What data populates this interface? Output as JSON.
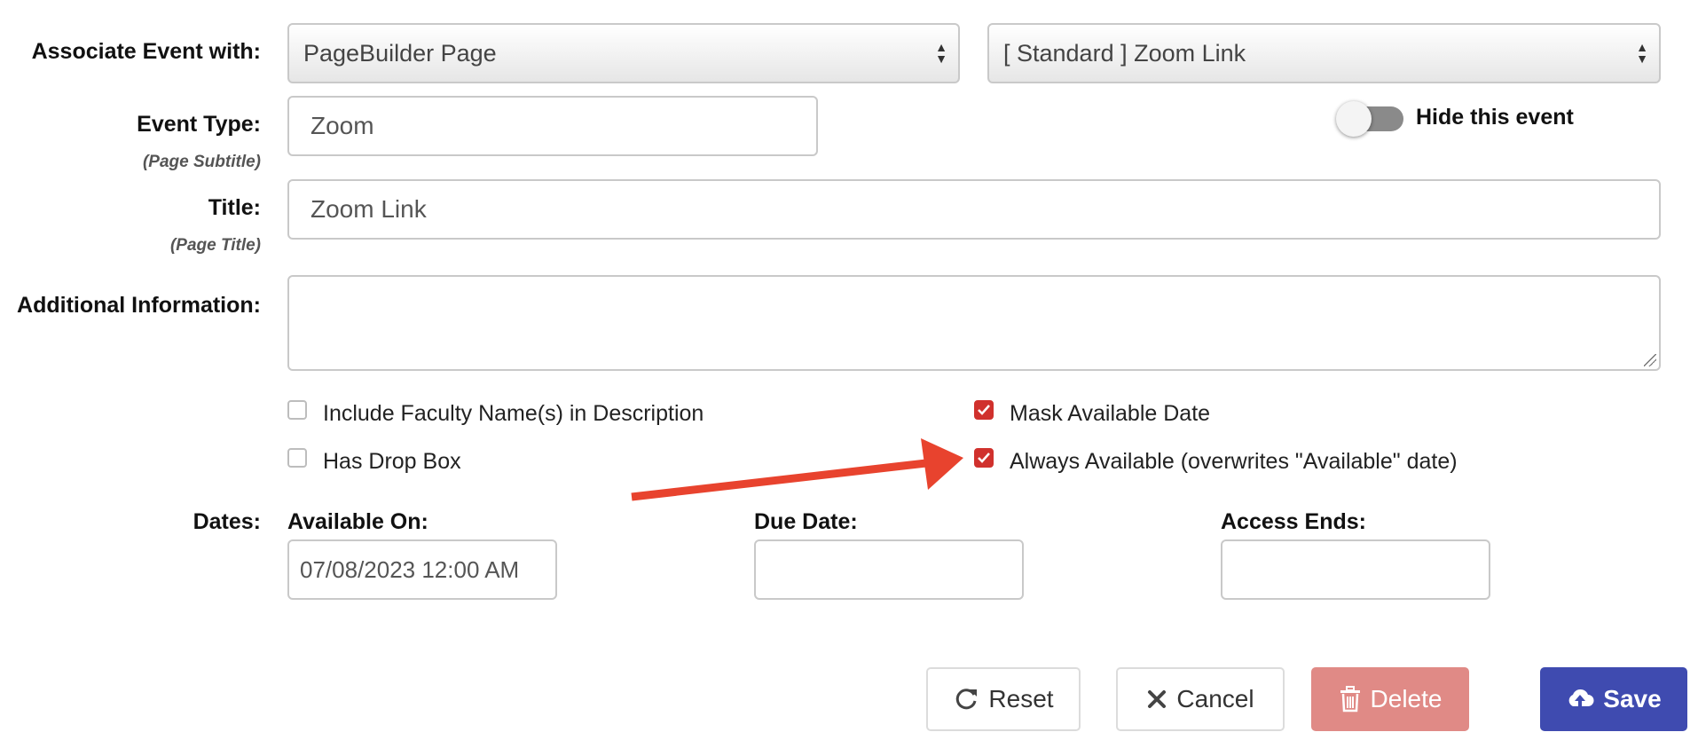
{
  "associate": {
    "label": "Associate Event with:",
    "type_select": "PageBuilder Page",
    "item_select": "[ Standard ] Zoom Link"
  },
  "event_type": {
    "label": "Event Type:",
    "sublabel": "(Page Subtitle)",
    "value": "Zoom"
  },
  "hide_toggle": {
    "label": "Hide this event",
    "on": false
  },
  "title": {
    "label": "Title:",
    "sublabel": "(Page Title)",
    "value": "Zoom Link"
  },
  "additional_info": {
    "label": "Additional Information:",
    "value": ""
  },
  "options": {
    "include_faculty": {
      "label": "Include Faculty Name(s) in Description",
      "checked": false
    },
    "has_drop_box": {
      "label": "Has Drop Box",
      "checked": false
    },
    "mask_available": {
      "label": "Mask Available Date",
      "checked": true
    },
    "always_available": {
      "label": "Always Available (overwrites \"Available\" date)",
      "checked": true
    }
  },
  "dates": {
    "label": "Dates:",
    "available_on": {
      "label": "Available On:",
      "value": "07/08/2023 12:00 AM"
    },
    "due_date": {
      "label": "Due Date:",
      "value": ""
    },
    "access_ends": {
      "label": "Access Ends:",
      "value": ""
    }
  },
  "buttons": {
    "reset": "Reset",
    "cancel": "Cancel",
    "delete": "Delete",
    "save": "Save"
  },
  "icons": {
    "reset": "refresh-icon",
    "cancel": "close-icon",
    "delete": "trash-icon",
    "save": "cloud-upload-icon",
    "annotation": "red-arrow"
  },
  "colors": {
    "checkbox_checked": "#d0312d",
    "save_button": "#3f4bb0",
    "delete_button": "#e08a86",
    "annotation_arrow": "#e8432e"
  }
}
